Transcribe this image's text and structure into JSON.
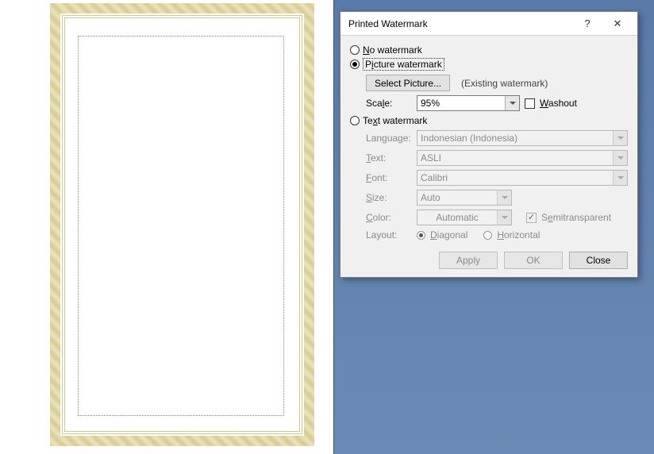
{
  "dialog": {
    "title": "Printed Watermark",
    "options": {
      "no_watermark": "No watermark",
      "picture_watermark": "Picture watermark",
      "text_watermark": "Text watermark"
    },
    "picture": {
      "select_button": "Select Picture...",
      "existing_label": "(Existing watermark)",
      "scale_label": "Scale:",
      "scale_value": "95%",
      "washout_label": "Washout"
    },
    "text": {
      "language_label": "Language:",
      "language_value": "Indonesian (Indonesia)",
      "text_label": "Text:",
      "text_value": "ASLI",
      "font_label": "Font:",
      "font_value": "Calibri",
      "size_label": "Size:",
      "size_value": "Auto",
      "color_label": "Color:",
      "color_value": "Automatic",
      "semitransparent_label": "Semitransparent",
      "layout_label": "Layout:",
      "layout_diagonal": "Diagonal",
      "layout_horizontal": "Horizontal"
    },
    "buttons": {
      "apply": "Apply",
      "ok": "OK",
      "close": "Close"
    }
  }
}
